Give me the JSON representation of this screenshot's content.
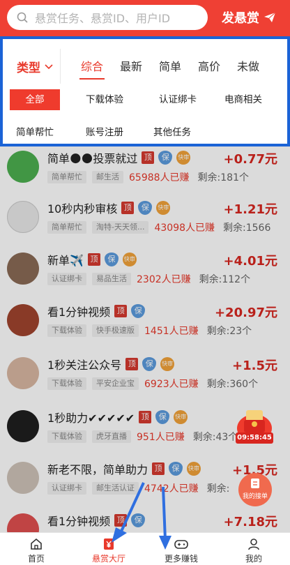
{
  "search": {
    "placeholder": "悬赏任务、悬赏ID、用户ID"
  },
  "header": {
    "post_label": "发悬赏"
  },
  "filter": {
    "type_label": "类型",
    "sorts": [
      "综合",
      "最新",
      "简单",
      "高价",
      "未做"
    ],
    "active_sort": "综合",
    "categories": [
      "全部",
      "下载体验",
      "认证绑卡",
      "电商相关",
      "简单帮忙",
      "账号注册",
      "其他任务"
    ],
    "active_category": "全部"
  },
  "badges": {
    "top": "顶",
    "guarantee": "保",
    "fast": "快审"
  },
  "tasks": [
    {
      "title": "简单🌑🌑投票就过",
      "price": "+0.77元",
      "tags": [
        "简单帮忙",
        "邮生活"
      ],
      "count": "65988人已赚",
      "remaining": "剩余:181个"
    },
    {
      "title": "10秒内秒审核",
      "price": "+1.21元",
      "tags": [
        "简单帮忙",
        "淘特-天天领..."
      ],
      "count": "43098人已赚",
      "remaining": "剩余:1566"
    },
    {
      "title": "新单✈️",
      "price": "+4.01元",
      "tags": [
        "认证绑卡",
        "易品生活"
      ],
      "count": "2302人已赚",
      "remaining": "剩余:112个"
    },
    {
      "title": "看1分钟视频",
      "price": "+20.97元",
      "tags": [
        "下载体验",
        "快手极速版"
      ],
      "count": "1451人已赚",
      "remaining": "剩余:23个"
    },
    {
      "title": "1秒关注公众号",
      "price": "+1.5元",
      "tags": [
        "下载体验",
        "平安企业宝"
      ],
      "count": "6923人已赚",
      "remaining": "剩余:360个"
    },
    {
      "title": "1秒助力✔✔✔✔✔",
      "price": "",
      "tags": [
        "下载体验",
        "虎牙直播"
      ],
      "count": "951人已赚",
      "remaining": "剩余:43个"
    },
    {
      "title": "新老不限，简单助力",
      "price": "+1.5元",
      "tags": [
        "认证绑卡",
        "邮生活认证"
      ],
      "count": "4742人已赚",
      "remaining": "剩余:"
    },
    {
      "title": "看1分钟视频",
      "price": "+7.18元",
      "tags": [],
      "count": "",
      "remaining": ""
    }
  ],
  "floating": {
    "countdown": "09:58:45",
    "my_jobs": "我的接单"
  },
  "tabbar": {
    "items": [
      "首页",
      "悬赏大厅",
      "更多赚钱",
      "我的"
    ],
    "active": "悬赏大厅"
  },
  "colors": {
    "brand": "#ef4034",
    "highlight_border": "#1b63d6",
    "annotation_arrow": "#2f6fe0"
  }
}
